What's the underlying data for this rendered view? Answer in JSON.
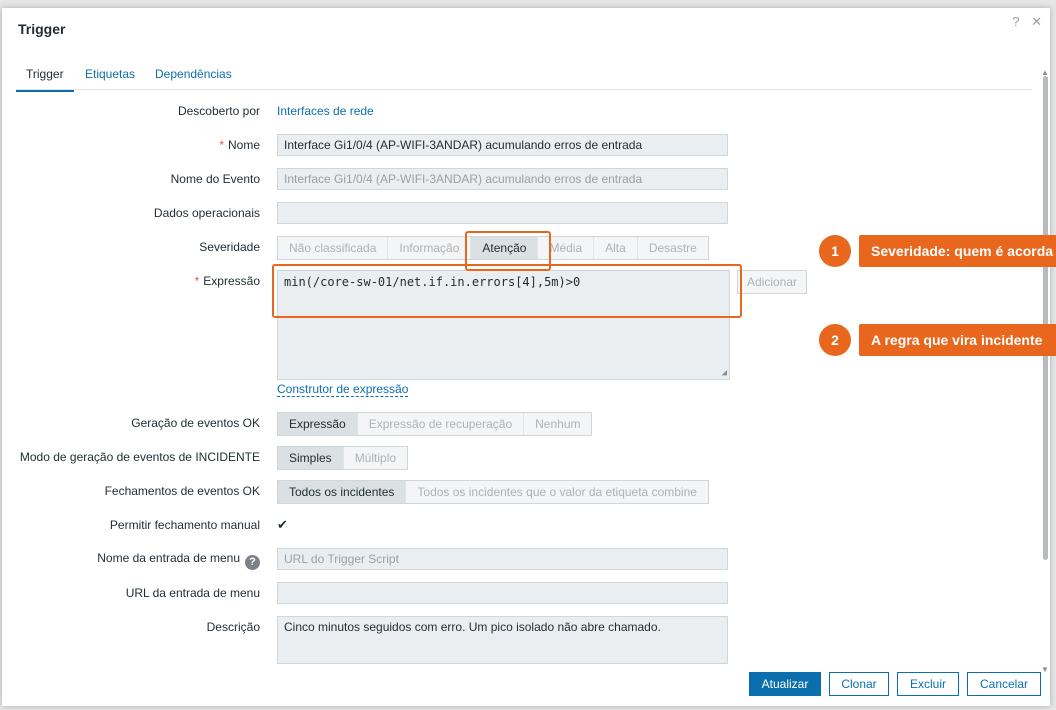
{
  "dialog": {
    "title": "Trigger",
    "help_icon": "?",
    "close_icon": "✕"
  },
  "tabs": [
    {
      "label": "Trigger",
      "active": true
    },
    {
      "label": "Etiquetas",
      "active": false
    },
    {
      "label": "Dependências",
      "active": false
    }
  ],
  "form": {
    "discovered_by": {
      "label": "Descoberto por",
      "value": "Interfaces de rede"
    },
    "name": {
      "required": "*",
      "label": "Nome",
      "value": "Interface Gi1/0/4 (AP-WIFI-3ANDAR) acumulando erros de entrada"
    },
    "event_name": {
      "label": "Nome do Evento",
      "placeholder": "Interface Gi1/0/4 (AP-WIFI-3ANDAR) acumulando erros de entrada"
    },
    "opdata": {
      "label": "Dados operacionais",
      "value": ""
    },
    "severity": {
      "label": "Severidade",
      "options": [
        "Não classificada",
        "Informação",
        "Atenção",
        "Média",
        "Alta",
        "Desastre"
      ],
      "selected": "Atenção"
    },
    "expression": {
      "required": "*",
      "label": "Expressão",
      "value": "min(/core-sw-01/net.if.in.errors[4],5m)>0",
      "add_button": "Adicionar",
      "builder_link": "Construtor de expressão"
    },
    "ok_event_generation": {
      "label": "Geração de eventos OK",
      "options": [
        "Expressão",
        "Expressão de recuperação",
        "Nenhum"
      ],
      "selected": "Expressão"
    },
    "problem_mode": {
      "label": "Modo de geração de eventos de INCIDENTE",
      "options": [
        "Simples",
        "Múltiplo"
      ],
      "selected": "Simples"
    },
    "ok_close": {
      "label": "Fechamentos de eventos OK",
      "options": [
        "Todos os incidentes",
        "Todos os incidentes que o valor da etiqueta combine"
      ],
      "selected": "Todos os incidentes"
    },
    "manual_close": {
      "label": "Permitir fechamento manual",
      "checked": true,
      "check_glyph": "✔"
    },
    "menu_name": {
      "label": "Nome da entrada de menu",
      "help_glyph": "?",
      "placeholder": "URL do Trigger Script"
    },
    "menu_url": {
      "label": "URL da entrada de menu",
      "value": ""
    },
    "description": {
      "label": "Descrição",
      "value": "Cinco minutos seguidos com erro. Um pico isolado não abre chamado."
    }
  },
  "footer": {
    "update": "Atualizar",
    "clone": "Clonar",
    "delete": "Excluir",
    "cancel": "Cancelar"
  },
  "callouts": [
    {
      "number": "1",
      "text": "Severidade: quem é acorda"
    },
    {
      "number": "2",
      "text": "A regra que vira incidente"
    }
  ],
  "colors": {
    "accent": "#0b6fad",
    "highlight": "#e8671c"
  }
}
